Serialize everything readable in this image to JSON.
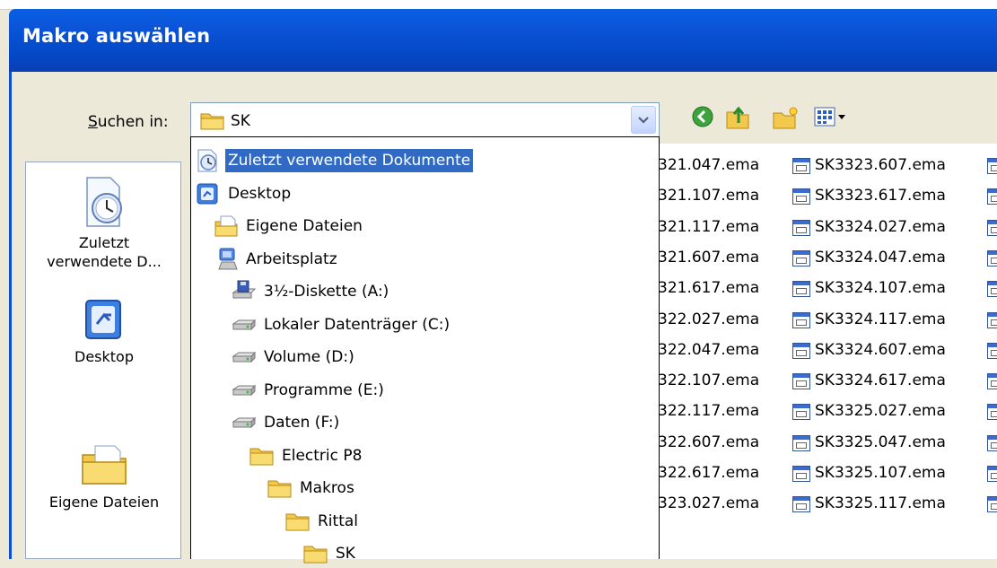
{
  "window": {
    "title": "Makro auswählen"
  },
  "look_in": {
    "label_prefix": "S",
    "label_rest": "uchen in:",
    "value": "SK"
  },
  "toolbar": {
    "icons": [
      "back-icon",
      "up-folder-icon",
      "new-folder-icon",
      "views-menu-icon"
    ]
  },
  "places": [
    {
      "label1": "Zuletzt",
      "label2": "verwendete D...",
      "icon": "recent-documents-icon"
    },
    {
      "label1": "Desktop",
      "label2": "",
      "icon": "desktop-icon"
    },
    {
      "label1": "Eigene Dateien",
      "label2": "",
      "icon": "my-documents-icon"
    }
  ],
  "dropdown": {
    "items": [
      {
        "label": "Zuletzt verwendete Dokumente",
        "icon": "recent-documents-icon",
        "selected": true
      },
      {
        "label": "Desktop",
        "icon": "desktop-icon"
      },
      {
        "label": "Eigene Dateien",
        "icon": "my-documents-icon"
      },
      {
        "label": "Arbeitsplatz",
        "icon": "my-computer-icon"
      },
      {
        "label": "3½-Diskette (A:)",
        "icon": "floppy-drive-icon"
      },
      {
        "label": "Lokaler Datenträger (C:)",
        "icon": "hard-drive-icon"
      },
      {
        "label": "Volume (D:)",
        "icon": "hard-drive-icon"
      },
      {
        "label": "Programme (E:)",
        "icon": "hard-drive-icon"
      },
      {
        "label": "Daten (F:)",
        "icon": "hard-drive-icon"
      },
      {
        "label": "Electric P8",
        "icon": "folder-icon"
      },
      {
        "label": "Makros",
        "icon": "folder-icon"
      },
      {
        "label": "Rittal",
        "icon": "folder-icon"
      },
      {
        "label": "SK",
        "icon": "folder-icon"
      }
    ]
  },
  "files": {
    "col1": [
      "321.047.ema",
      "321.107.ema",
      "321.117.ema",
      "321.607.ema",
      "321.617.ema",
      "322.027.ema",
      "322.047.ema",
      "322.107.ema",
      "322.117.ema",
      "322.607.ema",
      "322.617.ema",
      "323.027.ema"
    ],
    "col2": [
      "SK3323.607.ema",
      "SK3323.617.ema",
      "SK3324.027.ema",
      "SK3324.047.ema",
      "SK3324.107.ema",
      "SK3324.117.ema",
      "SK3324.607.ema",
      "SK3324.617.ema",
      "SK3325.027.ema",
      "SK3325.047.ema",
      "SK3325.107.ema",
      "SK3325.117.ema"
    ]
  }
}
